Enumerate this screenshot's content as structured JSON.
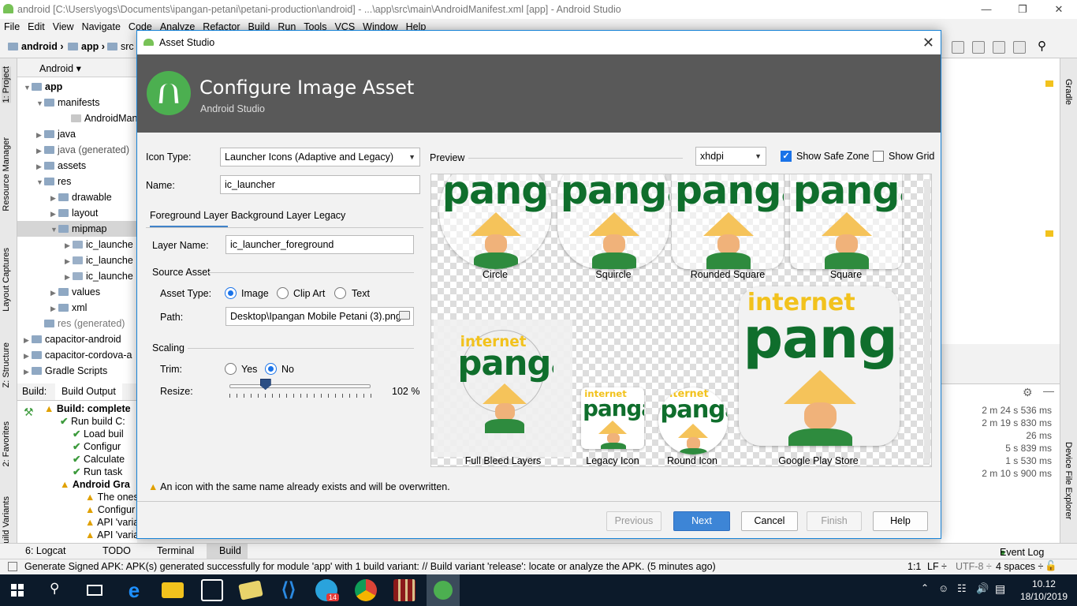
{
  "window": {
    "title": "android [C:\\Users\\yogs\\Documents\\ipangan-petani\\petani-production\\android] - ...\\app\\src\\main\\AndroidManifest.xml [app] - Android Studio"
  },
  "menu": [
    "File",
    "Edit",
    "View",
    "Navigate",
    "Code",
    "Analyze",
    "Refactor",
    "Build",
    "Run",
    "Tools",
    "VCS",
    "Window",
    "Help"
  ],
  "nav": {
    "crumb1": "android",
    "crumb2": "app",
    "crumb3": "src"
  },
  "left_tabs": {
    "project": "1: Project",
    "resource": "Resource Manager",
    "captures": "Layout Captures",
    "structure": "Z: Structure",
    "favorites": "2: Favorites",
    "variants": "Build Variants"
  },
  "right_tabs": {
    "gradle": "Gradle",
    "device": "Device File Explorer"
  },
  "project": {
    "view": "Android",
    "tree": [
      {
        "label": "app",
        "bold": true
      },
      {
        "label": "manifests"
      },
      {
        "label": "AndroidManif"
      },
      {
        "label": "java"
      },
      {
        "label": "java (generated)"
      },
      {
        "label": "assets"
      },
      {
        "label": "res"
      },
      {
        "label": "drawable"
      },
      {
        "label": "layout"
      },
      {
        "label": "mipmap"
      },
      {
        "label": "ic_launche"
      },
      {
        "label": "ic_launche"
      },
      {
        "label": "ic_launche"
      },
      {
        "label": "values"
      },
      {
        "label": "xml"
      },
      {
        "label": "res (generated)"
      },
      {
        "label": "capacitor-android"
      },
      {
        "label": "capacitor-cordova-a"
      },
      {
        "label": "Gradle Scripts"
      }
    ]
  },
  "build": {
    "tab1": "Build:",
    "tab2": "Build Output",
    "lines": [
      "Build: complete",
      "Run build C:",
      "Load buil",
      "Configur",
      "Calculate",
      "Run task",
      "Android Gra",
      "The ones",
      "Configur",
      "API 'varia",
      "API 'varia"
    ]
  },
  "timings": [
    "2 m 24 s 536 ms",
    "2 m 19 s 830 ms",
    "26 ms",
    "5 s 839 ms",
    "1 s 530 ms",
    "2 m 10 s 900 ms"
  ],
  "bottom_tabs": {
    "logcat": "6: Logcat",
    "todo": "TODO",
    "terminal": "Terminal",
    "build": "Build",
    "eventlog": "Event Log"
  },
  "status": {
    "message": "Generate Signed APK: APK(s) generated successfully for module 'app' with 1 build variant: // Build variant 'release': locate or analyze the APK. (5 minutes ago)",
    "pos": "1:1",
    "lf": "LF ÷",
    "enc": "UTF-8 ÷",
    "indent": "4 spaces ÷"
  },
  "clock": {
    "time": "10.12",
    "date": "18/10/2019"
  },
  "taskbar": {
    "badge": "14"
  },
  "dialog": {
    "title": "Asset Studio",
    "heading": "Configure Image Asset",
    "subheading": "Android Studio",
    "icon_type_label": "Icon Type:",
    "icon_type_value": "Launcher Icons (Adaptive and Legacy)",
    "name_label": "Name:",
    "name_value": "ic_launcher",
    "tabs": [
      "Foreground Layer",
      "Background Layer",
      "Legacy"
    ],
    "layer_name_label": "Layer Name:",
    "layer_name_value": "ic_launcher_foreground",
    "source_asset": "Source Asset",
    "asset_type_label": "Asset Type:",
    "asset_types": [
      "Image",
      "Clip Art",
      "Text"
    ],
    "asset_type_selected": "Image",
    "path_label": "Path:",
    "path_value": "Desktop\\Ipangan Mobile Petani (3).png",
    "scaling": "Scaling",
    "trim_label": "Trim:",
    "trim_yes": "Yes",
    "trim_no": "No",
    "trim_selected": "No",
    "resize_label": "Resize:",
    "resize_value": "102 %",
    "resize_percent": 102,
    "preview_label": "Preview",
    "density": "xhdpi",
    "show_safe_zone": "Show Safe Zone",
    "show_safe_zone_checked": true,
    "show_grid": "Show Grid",
    "show_grid_checked": false,
    "preview_captions": [
      "Circle",
      "Squircle",
      "Rounded Square",
      "Square",
      "Full Bleed Layers",
      "Legacy Icon",
      "Round Icon",
      "Google Play Store"
    ],
    "icon_text_top": "internet",
    "icon_text_main": "pangan",
    "warning": "An icon with the same name already exists and will be overwritten.",
    "buttons": {
      "previous": "Previous",
      "next": "Next",
      "cancel": "Cancel",
      "finish": "Finish",
      "help": "Help"
    }
  },
  "colors": {
    "accent": "#1a73e8",
    "header": "#595959",
    "android_green": "#78c257",
    "logo_green": "#0f6e2c",
    "logo_yellow": "#f2c21d"
  }
}
